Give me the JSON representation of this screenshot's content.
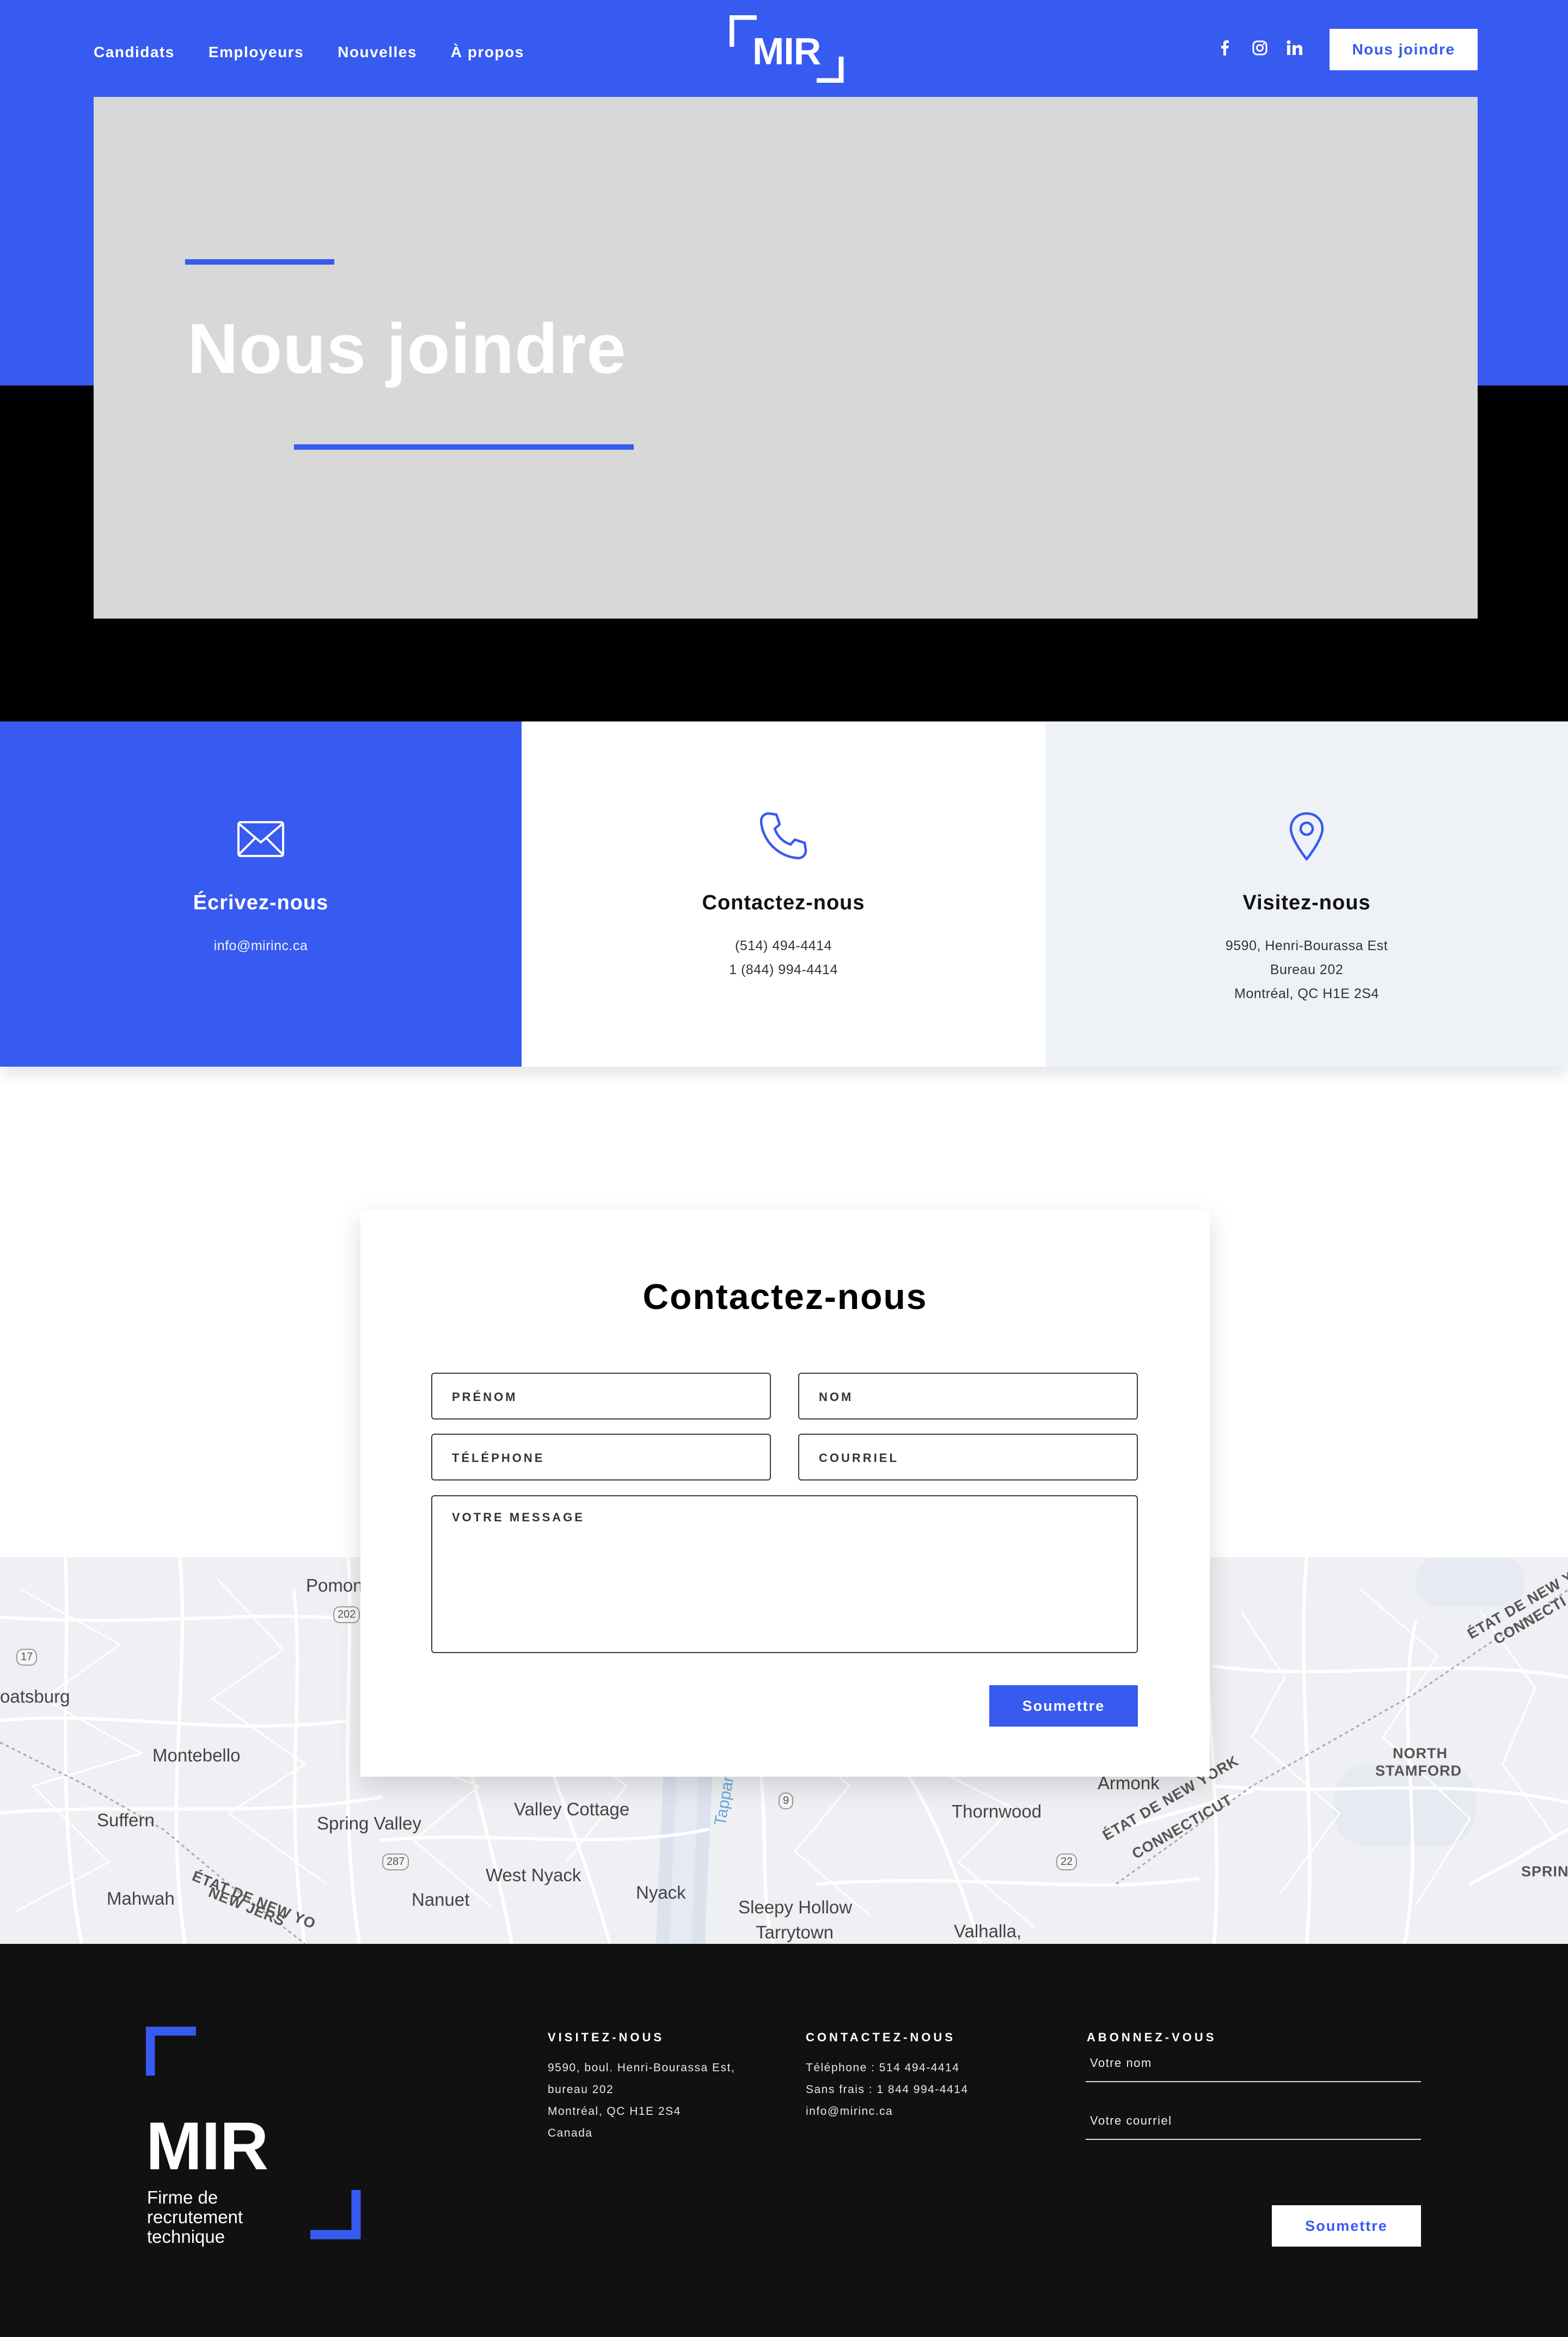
{
  "nav": {
    "items": [
      "Candidats",
      "Employeurs",
      "Nouvelles",
      "À propos"
    ],
    "join_label": "Nous joindre"
  },
  "logo": {
    "text": "MIR"
  },
  "social": {
    "icons": [
      "facebook-icon",
      "instagram-icon",
      "linkedin-icon"
    ]
  },
  "hero": {
    "title": "Nous joindre"
  },
  "cards": {
    "write": {
      "title": "Écrivez-nous",
      "lines": [
        "info@mirinc.ca"
      ]
    },
    "call": {
      "title": "Contactez-nous",
      "lines": [
        "(514) 494-4414",
        "1 (844) 994-4414"
      ]
    },
    "visit": {
      "title": "Visitez-nous",
      "lines": [
        "9590, Henri-Bourassa Est",
        "Bureau 202",
        "Montréal, QC H1E 2S4"
      ]
    }
  },
  "form": {
    "title": "Contactez-nous",
    "first_name": "PRÉNOM",
    "last_name": "NOM",
    "phone": "TÉLÉPHONE",
    "email": "COURRIEL",
    "message": "VOTRE MESSAGE",
    "submit": "Soumettre"
  },
  "map": {
    "labels": [
      "Pomona",
      "oatsburg",
      "Montebello",
      "Suffern",
      "Spring Valley",
      "Valley Cottage",
      "West Nyack",
      "Nanuet",
      "Nyack",
      "Mahwah",
      "Sleepy Hollow",
      "Tarrytown",
      "Thornwood",
      "Valhalla,",
      "Armonk",
      "NORTH",
      "STAMFORD",
      "SPRIN",
      "ÉTAT DE NEW YO",
      "NEW JERS",
      "ÉTAT DE NEW YORK",
      "CONNECTICUT",
      "ÉTAT DE NEW Y",
      "CONNECTI",
      "Tappan Ze"
    ],
    "shields": [
      "17",
      "202",
      "287",
      "9",
      "22"
    ]
  },
  "footer": {
    "logo_text": "MIR",
    "tagline": [
      "Firme de",
      "recrutement",
      "technique"
    ],
    "visit": {
      "heading": "VISITEZ-NOUS",
      "lines": [
        "9590, boul. Henri-Bourassa Est,",
        "bureau 202",
        "Montréal, QC H1E 2S4",
        "Canada"
      ]
    },
    "contact": {
      "heading": "CONTACTEZ-NOUS",
      "lines": [
        "Téléphone : 514 494-4414",
        "Sans frais : 1 844 994-4414",
        "info@mirinc.ca"
      ]
    },
    "subscribe": {
      "heading": "ABONNEZ-VOUS",
      "name_placeholder": "Votre nom",
      "email_placeholder": "Votre courriel",
      "submit": "Soumettre"
    }
  },
  "colors": {
    "accent": "#375af0",
    "black": "#000000",
    "footer": "#111111",
    "hero_panel": "#d8d8d8",
    "card_light": "#eef1f6"
  }
}
